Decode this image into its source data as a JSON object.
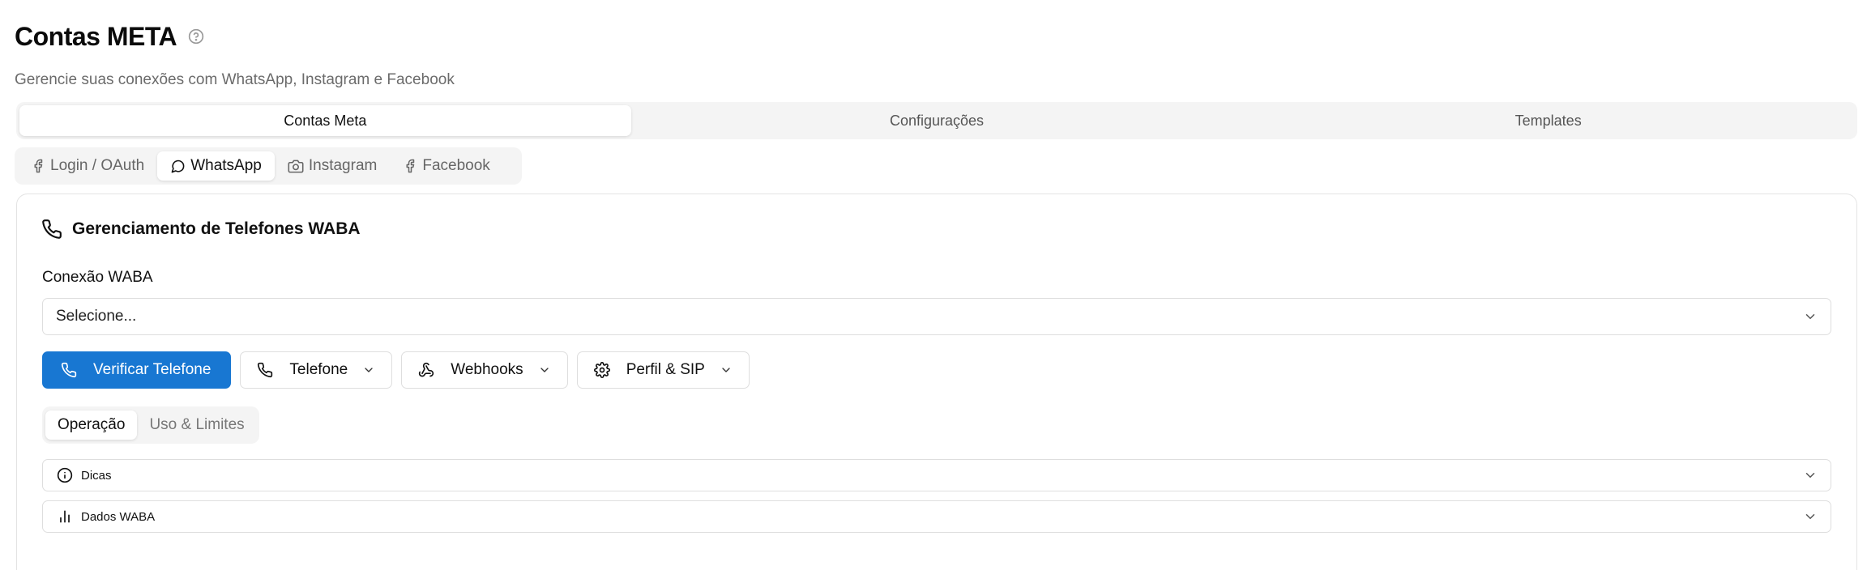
{
  "page": {
    "title": "Contas META",
    "subtitle": "Gerencie suas conexões com WhatsApp, Instagram e Facebook"
  },
  "main_tabs": [
    {
      "label": "Contas Meta",
      "active": true
    },
    {
      "label": "Configurações",
      "active": false
    },
    {
      "label": "Templates",
      "active": false
    }
  ],
  "sub_tabs": [
    {
      "label": "Login / OAuth",
      "icon": "facebook-icon",
      "active": false
    },
    {
      "label": "WhatsApp",
      "icon": "message-circle-icon",
      "active": true
    },
    {
      "label": "Instagram",
      "icon": "camera-icon",
      "active": false
    },
    {
      "label": "Facebook",
      "icon": "facebook-icon",
      "active": false
    }
  ],
  "card": {
    "title": "Gerenciamento de Telefones WABA",
    "title_icon": "phone-icon",
    "connection_label": "Conexão WABA",
    "connection_select": {
      "value": "Selecione..."
    }
  },
  "actions": [
    {
      "label": "Verificar Telefone",
      "icon": "phone-icon",
      "style": "primary"
    },
    {
      "label": "Telefone",
      "icon": "phone-icon",
      "style": "outline",
      "dropdown": true
    },
    {
      "label": "Webhooks",
      "icon": "webhook-icon",
      "style": "outline",
      "dropdown": true
    },
    {
      "label": "Perfil & SIP",
      "icon": "gear-icon",
      "style": "outline",
      "dropdown": true
    }
  ],
  "op_tabs": [
    {
      "label": "Operação",
      "active": true
    },
    {
      "label": "Uso & Limites",
      "active": false
    }
  ],
  "accordions": [
    {
      "label": "Dicas",
      "icon": "info-icon"
    },
    {
      "label": "Dados WABA",
      "icon": "bar-chart-icon"
    }
  ],
  "colors": {
    "primary": "#1877d2",
    "border": "#dedede",
    "tab_bg": "#f4f4f4",
    "muted_text": "#6b6b6b"
  }
}
